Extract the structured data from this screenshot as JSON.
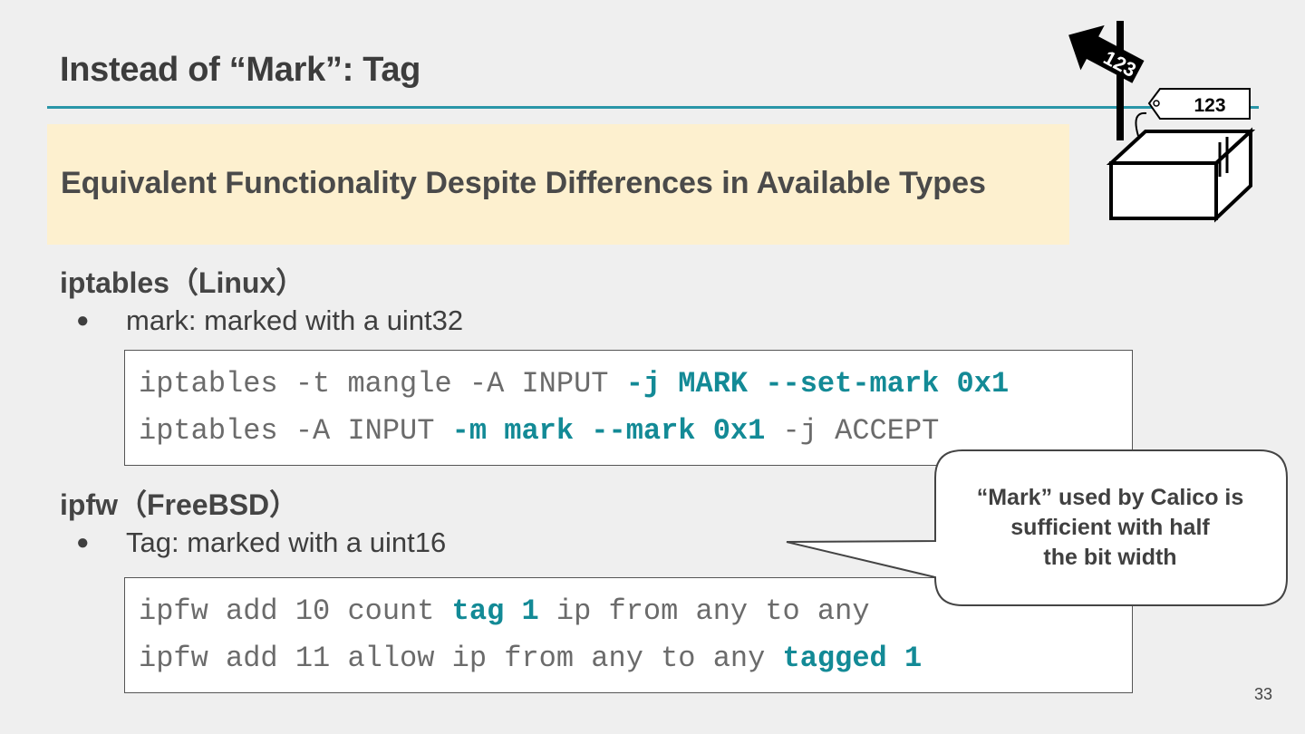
{
  "slide": {
    "title": "Instead of “Mark”: Tag",
    "banner": "Equivalent Functionality Despite Differences in Available Types",
    "page_number": "33"
  },
  "iptables": {
    "heading": "iptables（Linux）",
    "bullet_marker": "●",
    "bullet": "mark: marked with a uint32",
    "code": [
      {
        "pre": "iptables -t mangle -A INPUT ",
        "hl": "-j MARK --set-mark 0x1",
        "post": ""
      },
      {
        "pre": "iptables -A INPUT ",
        "hl": "-m mark --mark 0x1",
        "post": " -j ACCEPT"
      }
    ]
  },
  "ipfw": {
    "heading": "ipfw（FreeBSD）",
    "bullet_marker": "●",
    "bullet": "Tag: marked with a uint16",
    "code": [
      {
        "pre": "ipfw add 10 count ",
        "hl": "tag 1",
        "post": " ip from any to any"
      },
      {
        "pre": "ipfw add 11 allow ip from any to any ",
        "hl": "tagged 1",
        "post": ""
      }
    ]
  },
  "callout": {
    "lines": [
      "“Mark” used by Calico is",
      "sufficient with half",
      "the bit width"
    ]
  },
  "illustration": {
    "sign_label": "123",
    "tag_label": "123",
    "icon": "tagged-box-icon"
  },
  "colors": {
    "accent": "#2a96a8",
    "code_highlight": "#138a96",
    "banner_bg": "#fdf0cf",
    "background": "#efefef"
  }
}
